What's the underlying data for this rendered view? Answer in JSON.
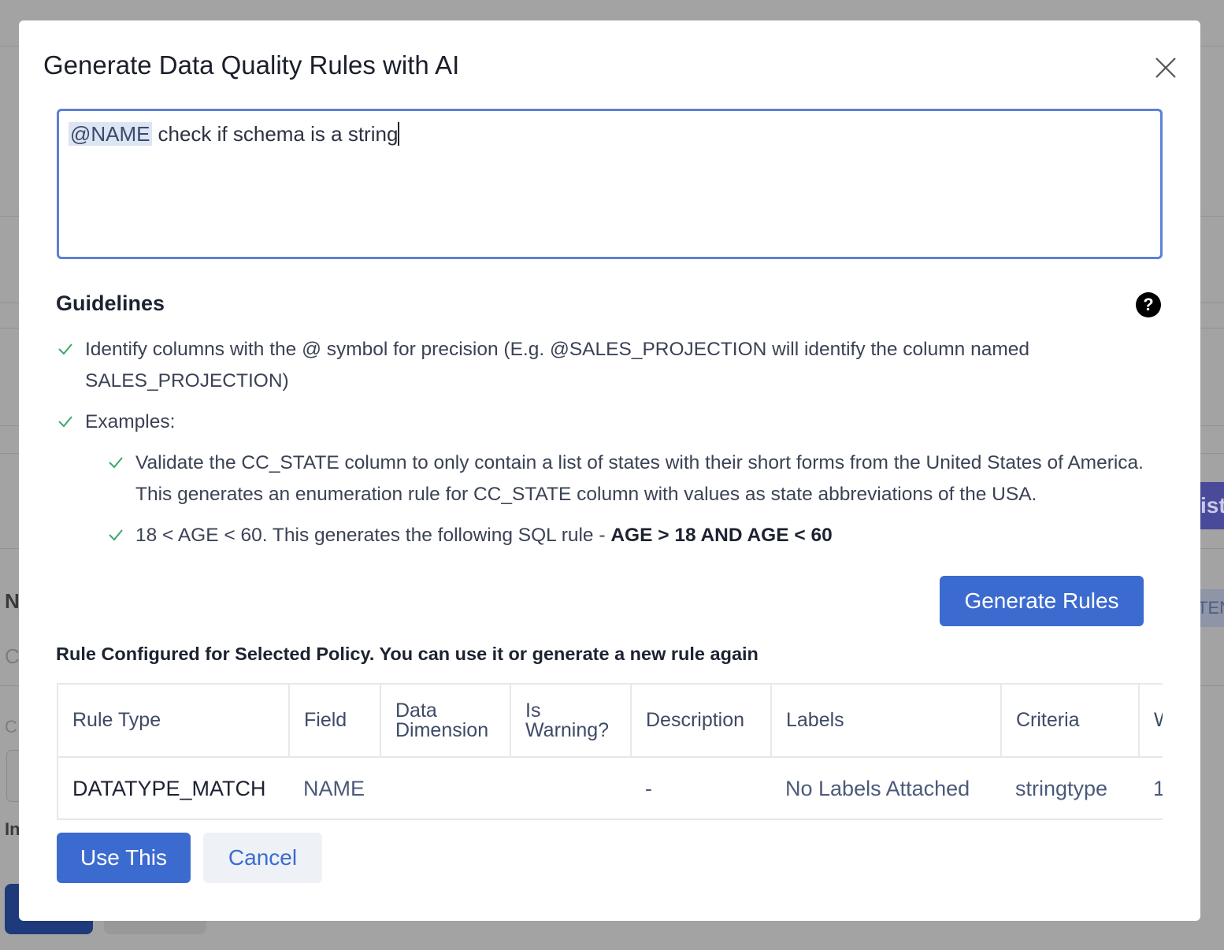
{
  "background": {
    "fragments": {
      "n": "N",
      "c1": "C",
      "c2": "C",
      "i": "In",
      "right_button": "ist",
      "right_tag": "TEN"
    }
  },
  "modal": {
    "title": "Generate Data Quality Rules with AI",
    "close_icon": "close-icon",
    "prompt": {
      "mention": "@NAME",
      "text": "check if schema is a string"
    },
    "guidelines": {
      "title": "Guidelines",
      "help_icon": "?",
      "items": [
        {
          "text": "Identify columns with the @ symbol for precision (E.g. @SALES_PROJECTION will identify the column named SALES_PROJECTION)"
        },
        {
          "text": "Examples:"
        },
        {
          "text": "Validate the CC_STATE column to only contain a list of states with their short forms from the United States of America. This generates an enumeration rule for CC_STATE column with values as state abbreviations of the USA."
        },
        {
          "text": "18 < AGE < 60. This generates the following SQL rule - ",
          "bold": "AGE > 18 AND AGE < 60"
        }
      ]
    },
    "generate_button": "Generate Rules",
    "rule_caption": "Rule Configured for Selected Policy. You can use it or generate a new rule again",
    "table": {
      "headers": [
        "Rule Type",
        "Field",
        "Data Dimension",
        "Is Warning?",
        "Description",
        "Labels",
        "Criteria",
        "W"
      ],
      "row": [
        "DATATYPE_MATCH",
        "NAME",
        "",
        "",
        "-",
        "No Labels Attached",
        "stringtype",
        "1"
      ]
    },
    "use_button": "Use This",
    "cancel_button": "Cancel"
  },
  "colors": {
    "accent": "#3c6bd0",
    "overlay": "#a3a3a3",
    "check": "#3aa86b"
  }
}
